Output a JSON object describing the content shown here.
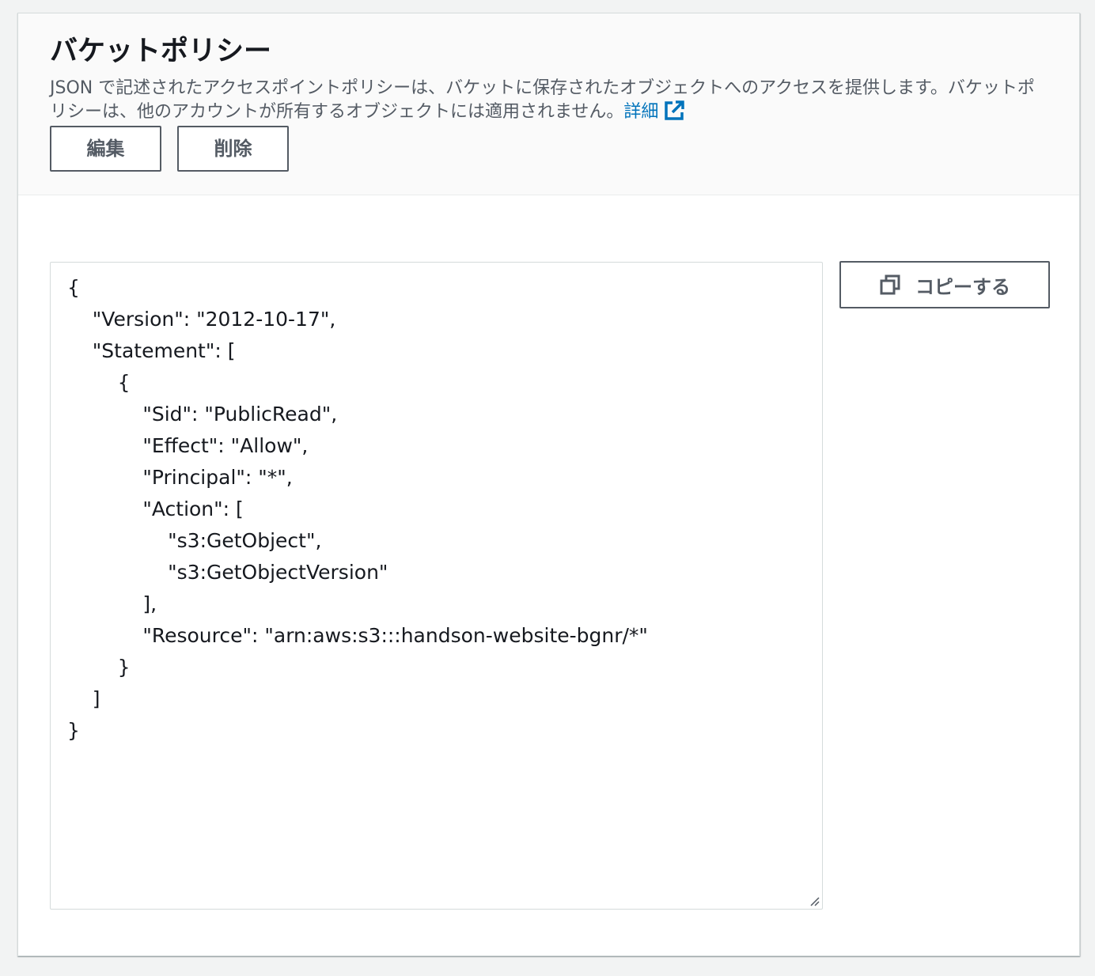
{
  "panel": {
    "title": "バケットポリシー",
    "description": "JSON で記述されたアクセスポイントポリシーは、バケットに保存されたオブジェクトへのアクセスを提供します。バケットポリシーは、他のアカウントが所有するオブジェクトには適用されません。",
    "learn_more_label": "詳細",
    "learn_more_icon": "external-link-icon",
    "edit_label": "編集",
    "delete_label": "削除"
  },
  "policy": {
    "text": "{\n    \"Version\": \"2012-10-17\",\n    \"Statement\": [\n        {\n            \"Sid\": \"PublicRead\",\n            \"Effect\": \"Allow\",\n            \"Principal\": \"*\",\n            \"Action\": [\n                \"s3:GetObject\",\n                \"s3:GetObjectVersion\"\n            ],\n            \"Resource\": \"arn:aws:s3:::handson-website-bgnr/*\"\n        }\n    ]\n}",
    "copy_label": "コピーする",
    "copy_icon": "copy-icon"
  },
  "colors": {
    "link": "#0073bb",
    "button_border": "#545b64",
    "header_bg": "#fafafa",
    "page_bg": "#f2f3f3"
  }
}
